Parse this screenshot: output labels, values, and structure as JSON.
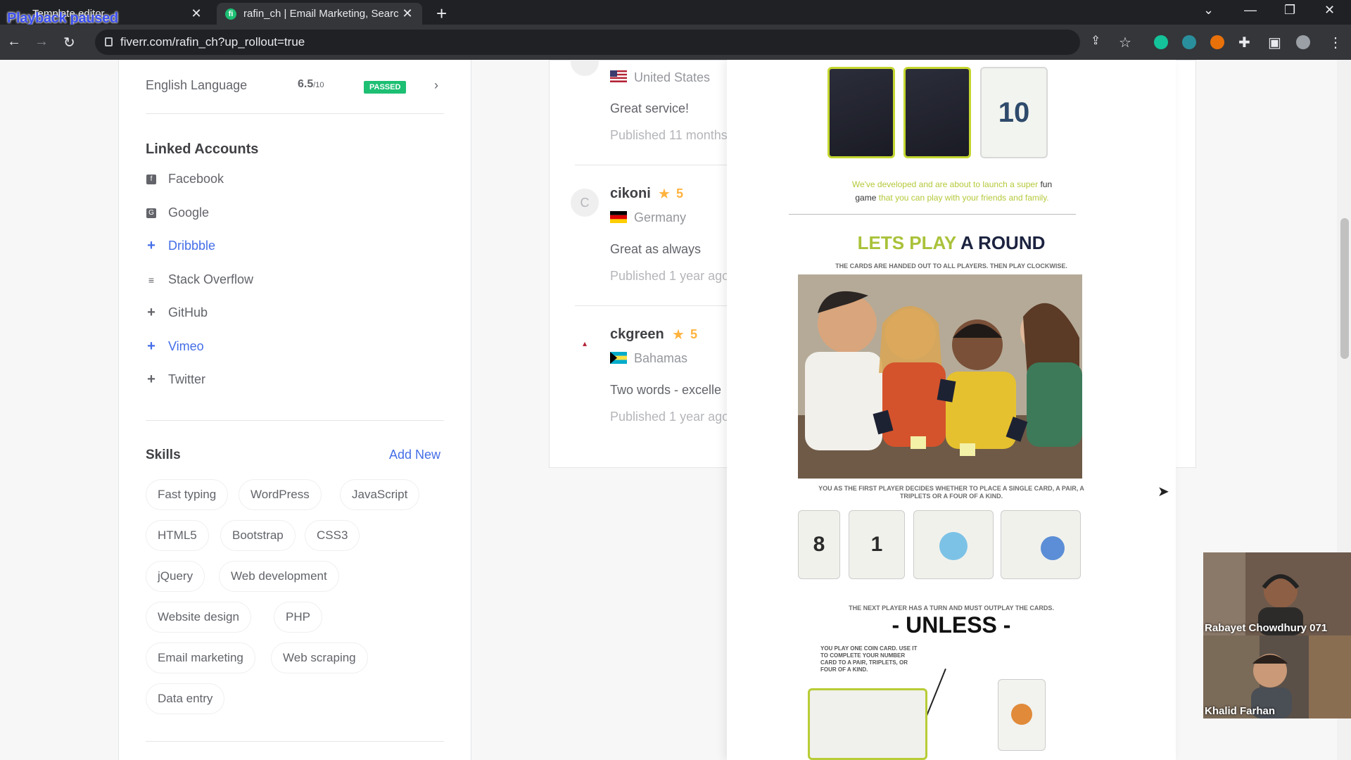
{
  "overlay_label": "Playback paused",
  "browser": {
    "tabs": [
      {
        "title": "Template editor"
      },
      {
        "title": "rafin_ch | Email Marketing, Searc",
        "favicon": "fi"
      }
    ],
    "url": "fiverr.com/rafin_ch?up_rollout=true"
  },
  "profile": {
    "language": {
      "name": "English Language",
      "score": "6.5",
      "score_max": "/10",
      "status": "PASSED"
    },
    "linked_accounts_title": "Linked Accounts",
    "linked_accounts": [
      {
        "label": "Facebook",
        "icon": "facebook-icon"
      },
      {
        "label": "Google",
        "icon": "google-icon"
      },
      {
        "label": "Dribbble",
        "icon": "plus-icon"
      },
      {
        "label": "Stack Overflow",
        "icon": "stack-overflow-icon"
      },
      {
        "label": "GitHub",
        "icon": "plus-icon"
      },
      {
        "label": "Vimeo",
        "icon": "plus-icon"
      },
      {
        "label": "Twitter",
        "icon": "plus-icon"
      }
    ],
    "skills_title": "Skills",
    "add_new": "Add New",
    "skills": [
      "Fast typing",
      "WordPress",
      "JavaScript",
      "HTML5",
      "Bootstrap",
      "CSS3",
      "jQuery",
      "Web development",
      "Website design",
      "PHP",
      "Email marketing",
      "Web scraping",
      "Data entry"
    ]
  },
  "reviews": [
    {
      "name": "",
      "rating": "",
      "country": "United States",
      "text": "Great service!",
      "date": "Published 11 months"
    },
    {
      "name": "cikoni",
      "avatar_letter": "C",
      "rating": "5",
      "country": "Germany",
      "text": "Great as always",
      "date": "Published 1 year ago"
    },
    {
      "name": "ckgreen",
      "rating": "5",
      "country": "Bahamas",
      "text": "Two words - excelle",
      "date": "Published 1 year ago"
    }
  ],
  "gallery": {
    "tagline_a": "We've developed and are about to launch a super",
    "tagline_b": "fun",
    "tagline_c": "game",
    "tagline_d": "that you can play with your friends and family.",
    "heading_a": "LETS PLAY",
    "heading_b": "A ROUND",
    "caption1": "THE CARDS ARE HANDED OUT TO ALL PLAYERS. THEN PLAY CLOCKWISE.",
    "caption2": "YOU AS THE FIRST PLAYER DECIDES WHETHER TO PLACE A SINGLE CARD, A PAIR, A TRIPLETS OR A FOUR OF A KIND.",
    "caption3": "THE NEXT PLAYER HAS A TURN AND MUST OUTPLAY THE CARDS.",
    "unless": "- UNLESS -",
    "caption4": "YOU PLAY ONE COIN CARD. USE IT TO COMPLETE YOUR NUMBER CARD TO A PAIR, TRIPLETS, OR FOUR OF A KIND.",
    "card_numbers": [
      "10",
      "8",
      "1"
    ]
  },
  "video_participants": [
    "Rabayet Chowdhury 071",
    "Khalid Farhan"
  ],
  "colors": {
    "fiverr_green": "#1dbf73",
    "link_blue": "#446ee7",
    "star": "#ffb33e"
  }
}
